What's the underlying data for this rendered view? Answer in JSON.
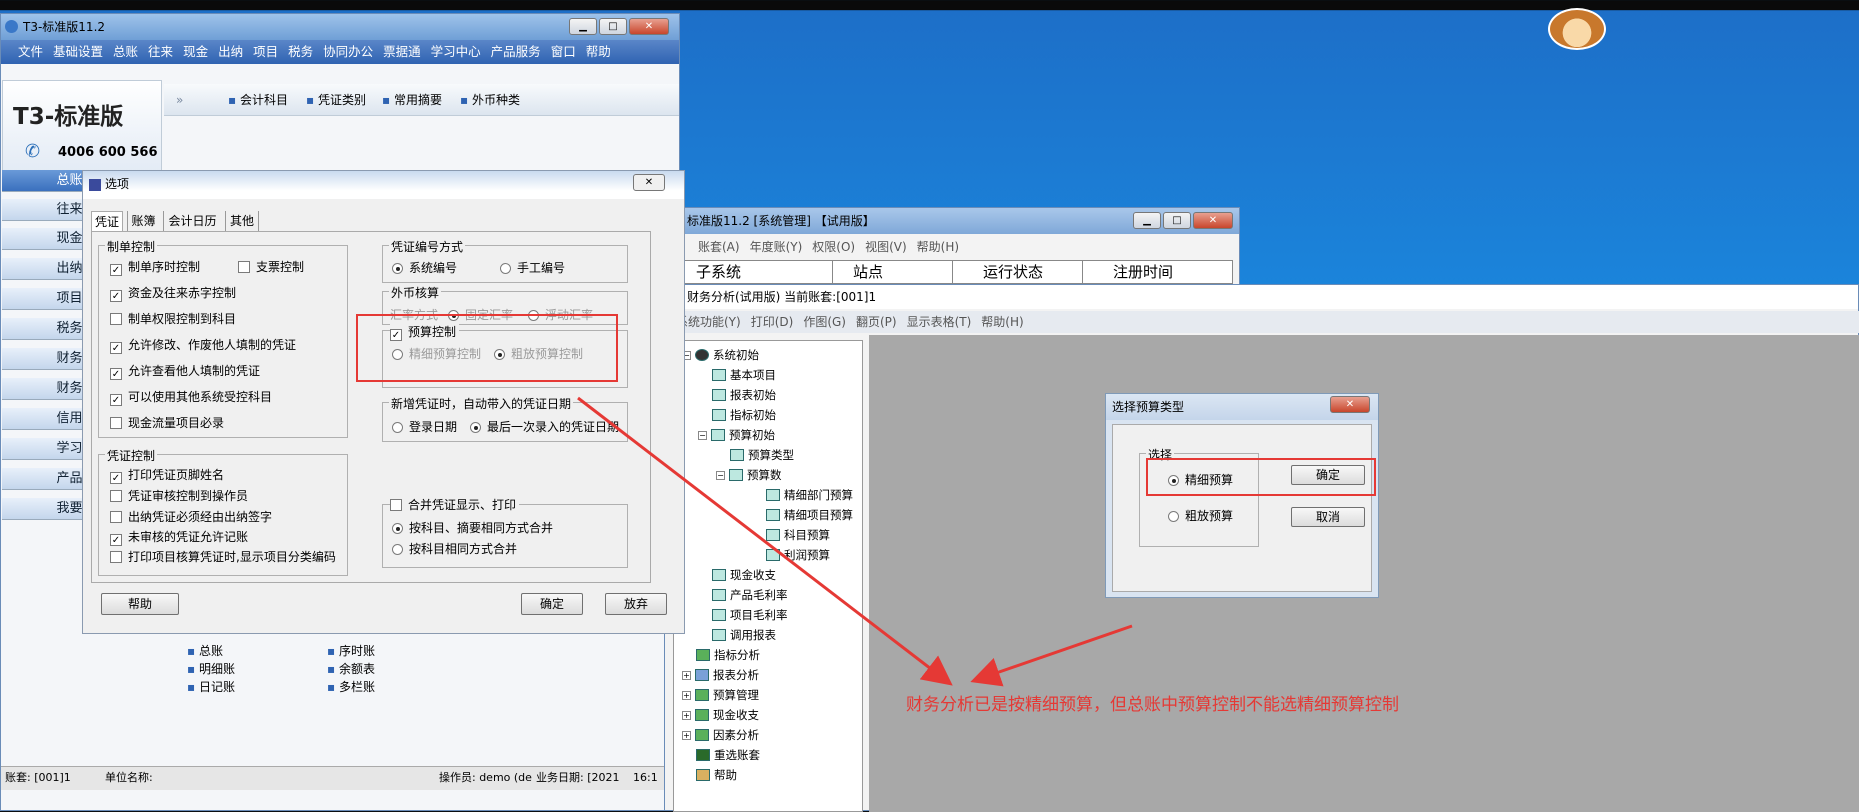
{
  "colors": {
    "accent": "#e53935",
    "brand": "#cc1b1b"
  },
  "t3": {
    "title": "T3-标准版11.2",
    "menu": [
      "文件",
      "基础设置",
      "总账",
      "往来",
      "现金",
      "出纳",
      "项目",
      "税务",
      "协同办公",
      "票据通",
      "学习中心",
      "产品服务",
      "窗口",
      "帮助"
    ],
    "logo": "T3-标准版",
    "phone": "4006 600 566",
    "toolbar": [
      "会计科目",
      "凭证类别",
      "常用摘要",
      "外币种类"
    ],
    "sidebar": [
      "总账",
      "往来",
      "现金",
      "出纳",
      "项目",
      "税务",
      "财务",
      "财务",
      "信用",
      "学习",
      "产品",
      "我要"
    ],
    "links_left": [
      "总账",
      "明细账",
      "日记账"
    ],
    "links_right": [
      "序时账",
      "余额表",
      "多栏账"
    ],
    "status": {
      "account": "账套: [001]1",
      "unit": "单位名称:",
      "operator": "操作员: demo (de",
      "date": "业务日期: [2021",
      "time": "16:1"
    }
  },
  "options": {
    "title": "选项",
    "tabs": [
      "凭证",
      "账簿",
      "会计日历",
      "其他"
    ],
    "g1": {
      "label": "制单控制",
      "items": [
        {
          "t": "制单序时控制",
          "c": true
        },
        {
          "t": "支票控制",
          "c": false
        },
        {
          "t": "资金及往来赤字控制",
          "c": true
        },
        {
          "t": "制单权限控制到科目",
          "c": false
        },
        {
          "t": "允许修改、作废他人填制的凭证",
          "c": true
        },
        {
          "t": "允许查看他人填制的凭证",
          "c": true
        },
        {
          "t": "可以使用其他系统受控科目",
          "c": true
        },
        {
          "t": "现金流量项目必录",
          "c": false
        }
      ]
    },
    "g2": {
      "label": "凭证控制",
      "items": [
        {
          "t": "打印凭证页脚姓名",
          "c": true
        },
        {
          "t": "凭证审核控制到操作员",
          "c": false
        },
        {
          "t": "出纳凭证必须经由出纳签字",
          "c": false
        },
        {
          "t": "未审核的凭证允许记账",
          "c": true
        },
        {
          "t": "打印项目核算凭证时,显示项目分类编码",
          "c": false
        }
      ]
    },
    "g3": {
      "label": "凭证编号方式",
      "opt1": "系统编号",
      "opt2": "手工编号"
    },
    "g4": {
      "label": "外币核算",
      "sub": "汇率方式",
      "opt1": "固定汇率",
      "opt2": "浮动汇率"
    },
    "g5": {
      "label": "预算控制",
      "opt1": "精细预算控制",
      "opt2": "粗放预算控制"
    },
    "g6": {
      "label": "新增凭证时，自动带入的凭证日期",
      "opt1": "登录日期",
      "opt2": "最后一次录入的凭证日期"
    },
    "g7": {
      "label": "合并凭证显示、打印",
      "opt1": "按科目、摘要相同方式合并",
      "opt2": "按科目相同方式合并"
    },
    "buttons": {
      "help": "帮助",
      "ok": "确定",
      "cancel": "放弃"
    }
  },
  "sysmgr": {
    "title": "标准版11.2 [系统管理] 【试用版】",
    "menu": [
      "账套(A)",
      "年度账(Y)",
      "权限(O)",
      "视图(V)",
      "帮助(H)"
    ],
    "cols": [
      "子系统",
      "站点",
      "运行状态",
      "注册时间"
    ]
  },
  "fa": {
    "title": "财务分析(试用版)  当前账套:[001]1",
    "menu": [
      "系统功能(Y)",
      "打印(D)",
      "作图(G)",
      "翻页(P)",
      "显示表格(T)",
      "帮助(H)"
    ],
    "tree": [
      "系统初始",
      "基本项目",
      "报表初始",
      "指标初始",
      "预算初始",
      "预算类型",
      "预算数",
      "精细部门预算",
      "精细项目预算",
      "科目预算",
      "利润预算",
      "现金收支",
      "产品毛利率",
      "项目毛利率",
      "调用报表",
      "指标分析",
      "报表分析",
      "预算管理",
      "现金收支",
      "因素分析",
      "重选账套",
      "帮助"
    ]
  },
  "budget": {
    "title": "选择预算类型",
    "group": "选择",
    "opt1": "精细预算",
    "opt2": "粗放预算",
    "ok": "确定",
    "cancel": "取消"
  },
  "annotation": "财务分析已是按精细预算，但总账中预算控制不能选精细预算控制"
}
